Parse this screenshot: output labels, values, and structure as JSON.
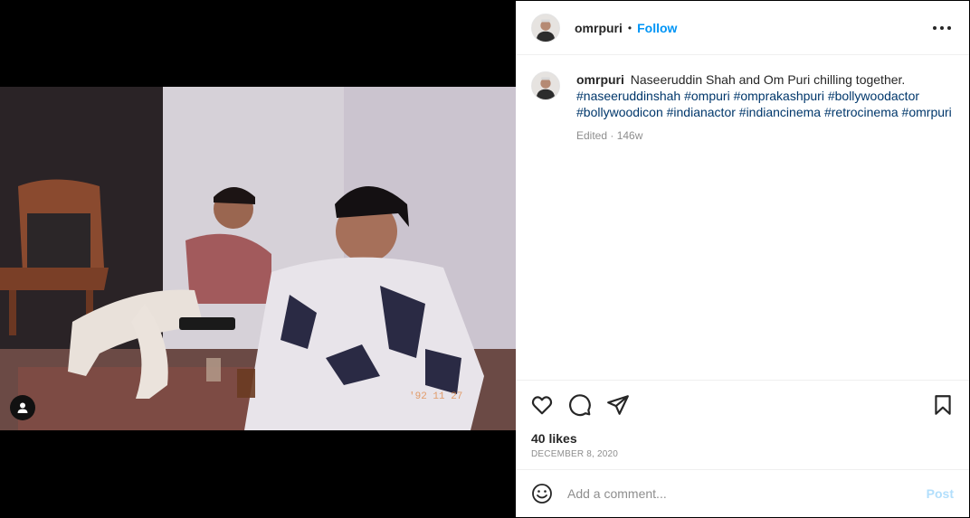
{
  "post": {
    "username": "omrpuri",
    "separator": "•",
    "follow_label": "Follow",
    "caption": {
      "text": "Naseeruddin Shah and Om Puri chilling together.",
      "hashtags": "#naseeruddinshah #ompuri #omprakashpuri #bollywoodactor #bollywoodicon #indianactor #indiancinema #retrocinema #omrpuri",
      "meta": "Edited · 146w"
    },
    "likes": "40 likes",
    "date": "DECEMBER 8, 2020",
    "comment": {
      "placeholder": "Add a comment...",
      "post_label": "Post"
    }
  },
  "icons": {
    "more": "more-options-icon",
    "like": "heart-icon",
    "comment": "comment-icon",
    "share": "share-icon",
    "save": "bookmark-icon",
    "emoji": "emoji-icon",
    "tag": "user-tag-icon"
  },
  "colors": {
    "link": "#0095f6",
    "hashtag": "#00376b",
    "muted": "#8e8e8e",
    "post_disabled": "#b2dffc"
  }
}
